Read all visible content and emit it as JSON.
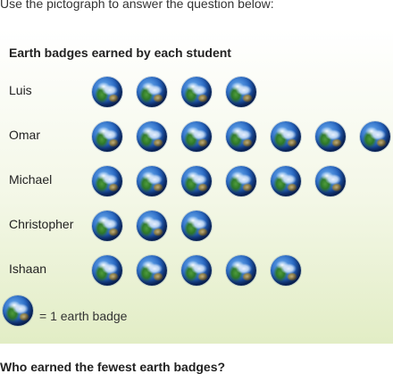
{
  "instruction": "Use the pictograph to answer the question below:",
  "chart_data": {
    "type": "pictograph",
    "title": "Earth badges earned by each student",
    "categories": [
      "Luis",
      "Omar",
      "Michael",
      "Christopher",
      "Ishaan"
    ],
    "values": [
      4,
      7,
      6,
      3,
      5
    ],
    "icon": "earth-globe-icon",
    "key": {
      "icon_value": 1,
      "label": "= 1 earth badge"
    }
  },
  "question": "Who earned the fewest earth badges?"
}
